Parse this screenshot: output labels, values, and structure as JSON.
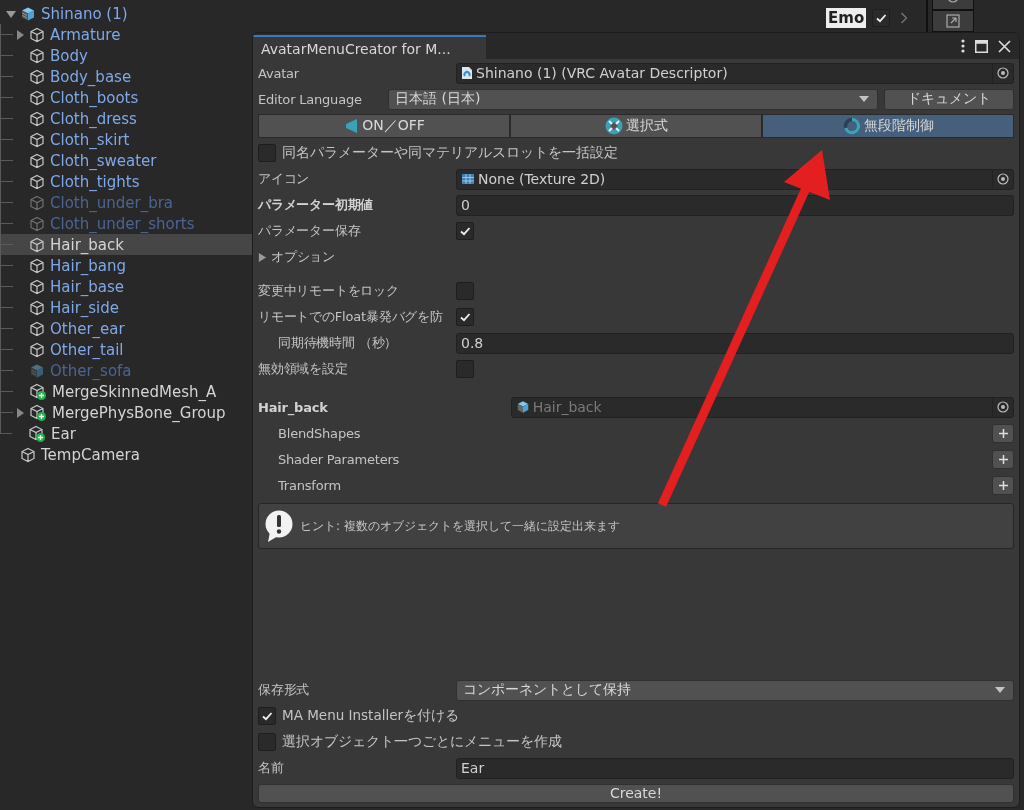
{
  "hierarchy": {
    "items": [
      {
        "name": "Shinano (1)",
        "kind": "prefab_root",
        "prefab": true,
        "active": true,
        "selected": false,
        "expanded": true,
        "children": [
          {
            "name": "Armature",
            "kind": "object",
            "prefab": true,
            "active": true,
            "selected": false,
            "expanded": false
          },
          {
            "name": "Body",
            "kind": "object",
            "prefab": true,
            "active": true,
            "selected": false
          },
          {
            "name": "Body_base",
            "kind": "object",
            "prefab": true,
            "active": true,
            "selected": false
          },
          {
            "name": "Cloth_boots",
            "kind": "object",
            "prefab": true,
            "active": true,
            "selected": false
          },
          {
            "name": "Cloth_dress",
            "kind": "object",
            "prefab": true,
            "active": true,
            "selected": false
          },
          {
            "name": "Cloth_skirt",
            "kind": "object",
            "prefab": true,
            "active": true,
            "selected": false
          },
          {
            "name": "Cloth_sweater",
            "kind": "object",
            "prefab": true,
            "active": true,
            "selected": false
          },
          {
            "name": "Cloth_tights",
            "kind": "object",
            "prefab": true,
            "active": true,
            "selected": false
          },
          {
            "name": "Cloth_under_bra",
            "kind": "object",
            "prefab": true,
            "active": false,
            "selected": false
          },
          {
            "name": "Cloth_under_shorts",
            "kind": "object",
            "prefab": true,
            "active": false,
            "selected": false
          },
          {
            "name": "Hair_back",
            "kind": "object",
            "active": true,
            "selected": true
          },
          {
            "name": "Hair_bang",
            "kind": "object",
            "prefab": true,
            "active": true,
            "selected": false
          },
          {
            "name": "Hair_base",
            "kind": "object",
            "prefab": true,
            "active": true,
            "selected": false
          },
          {
            "name": "Hair_side",
            "kind": "object",
            "prefab": true,
            "active": true,
            "selected": false
          },
          {
            "name": "Other_ear",
            "kind": "object",
            "prefab": true,
            "active": true,
            "selected": false
          },
          {
            "name": "Other_tail",
            "kind": "object",
            "prefab": true,
            "active": true,
            "selected": false
          },
          {
            "name": "Other_sofa",
            "kind": "prefab_root",
            "prefab": true,
            "active": false,
            "selected": false
          },
          {
            "name": "MergeSkinnedMesh_A",
            "kind": "added",
            "prefab": false,
            "active": true,
            "selected": false
          },
          {
            "name": "MergePhysBone_Group",
            "kind": "added",
            "prefab": false,
            "active": true,
            "selected": false,
            "expanded": false
          },
          {
            "name": "Ear",
            "kind": "added",
            "prefab": false,
            "active": true,
            "selected": false
          }
        ]
      },
      {
        "name": "TempCamera",
        "kind": "object",
        "prefab": false,
        "active": true,
        "selected": false
      }
    ]
  },
  "scene_toolbar": {
    "label": "Emo",
    "checked": true
  },
  "window": {
    "tab_title": "AvatarMenuCreator for M...",
    "avatar_row": {
      "label": "Avatar",
      "value": "Shinano (1) (VRC Avatar Descriptor)"
    },
    "language_row": {
      "label": "Editor Language",
      "value": "日本語 (日本)",
      "button": "ドキュメント"
    },
    "mode_tabs": [
      {
        "label": "ON／OFF",
        "kind": "toggle",
        "selected": false
      },
      {
        "label": "選択式",
        "kind": "choose",
        "selected": false
      },
      {
        "label": "無段階制御",
        "kind": "radial",
        "selected": true
      }
    ],
    "bulk_setting": {
      "label": "同名パラメーターや同マテリアルスロットを一括設定",
      "checked": false
    },
    "settings": [
      {
        "kind": "object_field",
        "label": "アイコン",
        "value": "None (Texture 2D)"
      },
      {
        "kind": "text_field",
        "label": "パラメーター初期値",
        "value": "0",
        "bold": true
      },
      {
        "kind": "checkbox",
        "label": "パラメーター保存",
        "checked": true
      },
      {
        "kind": "foldout",
        "label": "オプション",
        "expanded": false
      }
    ],
    "options": [
      {
        "kind": "checkbox",
        "label": "変更中リモートをロック",
        "checked": false
      },
      {
        "kind": "checkbox",
        "label": "リモートでのFloat暴発バグを防",
        "checked": true
      },
      {
        "kind": "text_field",
        "label": "同期待機時間 （秒）",
        "value": "0.8",
        "indented": true
      },
      {
        "kind": "checkbox",
        "label": "無効領域を設定",
        "checked": false
      }
    ],
    "target": {
      "name": "Hair_back",
      "field_value": "Hair_back",
      "disabled": true,
      "sections": [
        "BlendShapes",
        "Shader Parameters",
        "Transform"
      ]
    },
    "help": {
      "text": "ヒント: 複数のオブジェクトを選択して一緒に設定出来ます"
    },
    "output": [
      {
        "kind": "dropdown",
        "label": "保存形式",
        "value": "コンポーネントとして保持"
      },
      {
        "kind": "toggle_left",
        "label": "MA Menu Installerを付ける",
        "checked": true
      },
      {
        "kind": "toggle_left",
        "label": "選択オブジェクト一つごとにメニューを作成",
        "checked": false
      },
      {
        "kind": "text_field",
        "label": "名前",
        "value": "Ear"
      }
    ],
    "create_button": "Create!"
  }
}
